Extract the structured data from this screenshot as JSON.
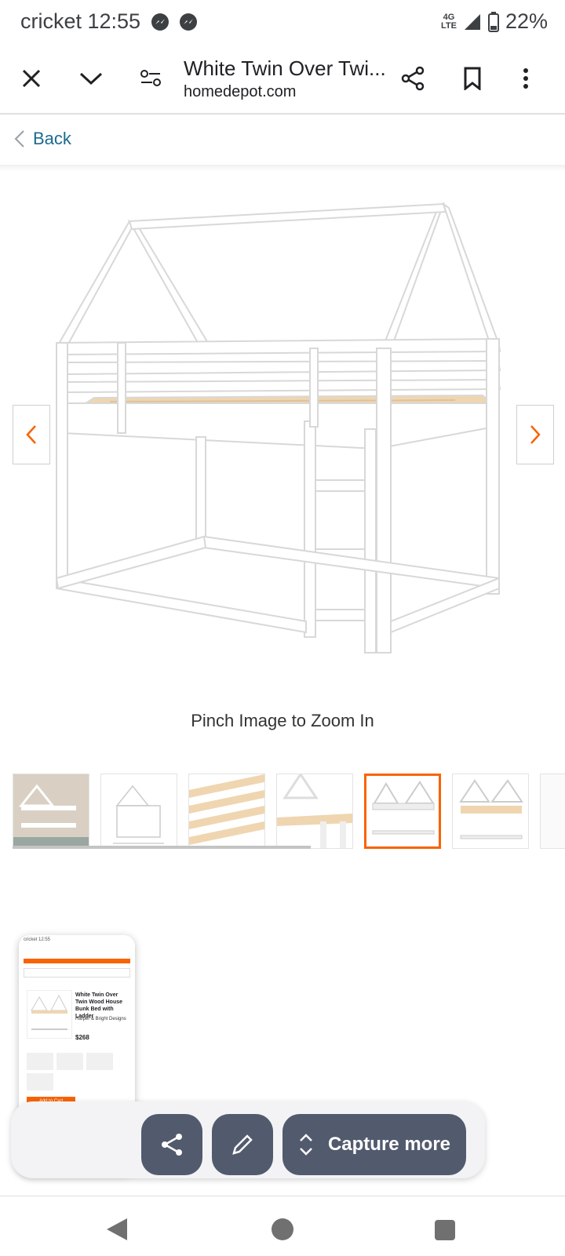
{
  "status": {
    "carrier_time": "cricket 12:55",
    "network": "4G",
    "network_sub": "LTE",
    "battery": "22%"
  },
  "browser": {
    "page_title": "White Twin Over Twi...",
    "url": "homedepot.com"
  },
  "page": {
    "back_label": "Back",
    "zoom_hint": "Pinch Image to Zoom In",
    "thumbnails": [
      "lifestyle-photo",
      "dimensions-diagram",
      "slats-closeup",
      "ladder-closeup",
      "front-view",
      "side-view"
    ],
    "selected_thumbnail": 4
  },
  "preview": {
    "title": "White Twin Over Twin Wood House Bunk Bed with Ladder",
    "brand": "Harper & Bright Designs",
    "price": "$268",
    "cta": "Add to Cart"
  },
  "actions": {
    "capture_more_label": "Capture more"
  },
  "colors": {
    "brand_orange": "#f96302",
    "link_blue": "#1b6b91",
    "action_button": "#525a6e"
  }
}
